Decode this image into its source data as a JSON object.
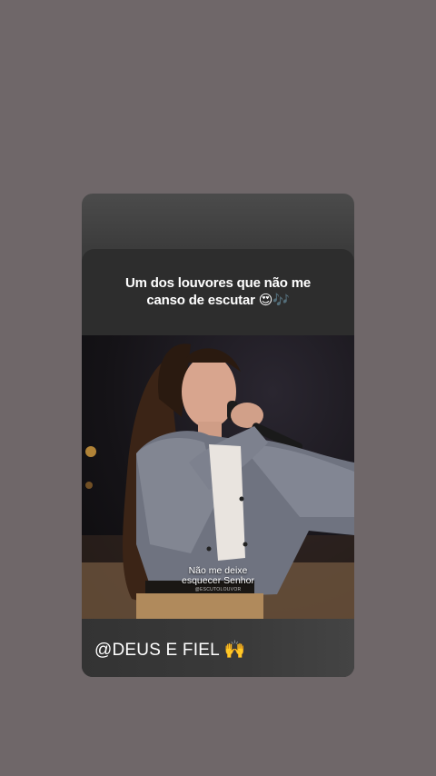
{
  "story": {
    "caption": "Um dos louvores que não me canso de escutar",
    "caption_emojis": "😍🎶",
    "video": {
      "subtitle_line1": "Não me deixe",
      "subtitle_line2": "esquecer Senhor",
      "watermark": "@ESCUTOLOUVOR"
    },
    "mention": "@DEUS E FIEL",
    "mention_emoji": "🙌"
  },
  "colors": {
    "background": "#6f6769",
    "card": "#2d2d2d",
    "text": "#ffffff"
  }
}
